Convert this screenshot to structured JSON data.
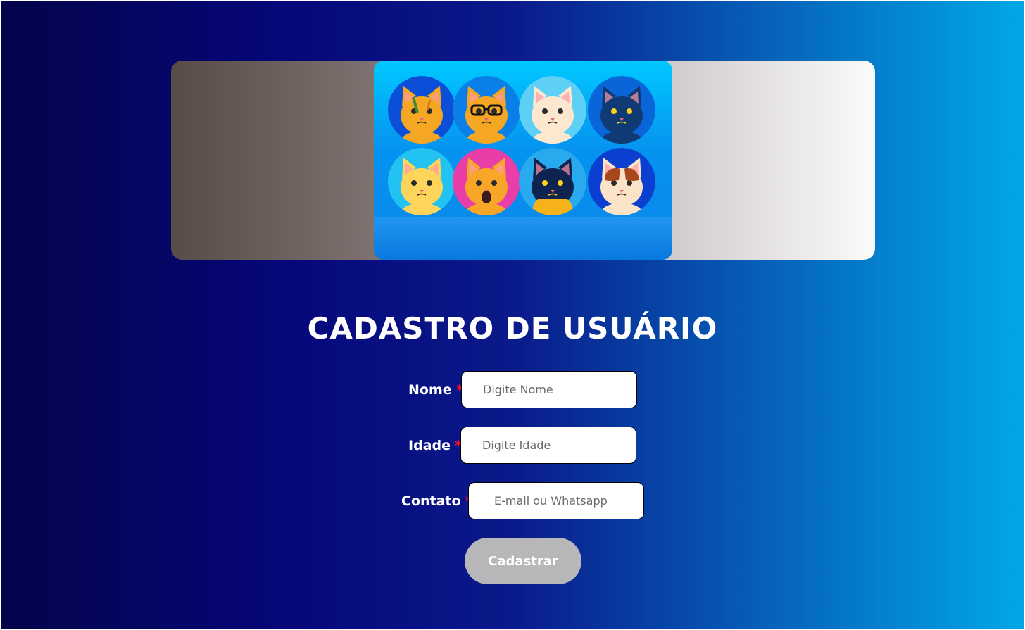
{
  "banner": {
    "image_alt": "cat-avatars-illustration",
    "cats": [
      {
        "bg": "#0b4fd8",
        "face": "#f5a623",
        "style": "tabby"
      },
      {
        "bg": "#0a7fe8",
        "face": "#f5a623",
        "style": "glasses"
      },
      {
        "bg": "#5fd0f5",
        "face": "#fbe8cf",
        "style": "white"
      },
      {
        "bg": "#0a66d8",
        "face": "#103a74",
        "style": "dark"
      },
      {
        "bg": "#22c2f2",
        "face": "#ffd45a",
        "style": "yellow"
      },
      {
        "bg": "#e93ea8",
        "face": "#f7a628",
        "style": "yawn"
      },
      {
        "bg": "#29a9ee",
        "face": "#0f2350",
        "style": "black-hood"
      },
      {
        "bg": "#0a3fd0",
        "face": "#fbe3c7",
        "style": "calico"
      }
    ]
  },
  "form": {
    "title": "CADASTRO DE USUÁRIO",
    "required_mark": "*",
    "fields": [
      {
        "label": "Nome",
        "placeholder": "Digite Nome"
      },
      {
        "label": "Idade",
        "placeholder": "Digite Idade"
      },
      {
        "label": "Contato",
        "placeholder": "E-mail ou Whatsapp"
      }
    ],
    "submit_label": "Cadastrar"
  },
  "colors": {
    "required": "#ff0a2a",
    "button": "#b7b6b8"
  }
}
